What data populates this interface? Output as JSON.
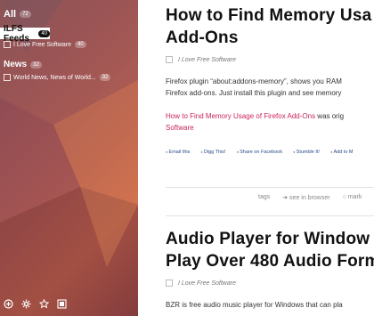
{
  "sidebar": {
    "all": {
      "label": "All",
      "count": "72"
    },
    "ilfs": {
      "label": "ILFS Feeds",
      "count": "40"
    },
    "ilfs_feed": {
      "label": "I Love Free Software",
      "count": "40"
    },
    "news": {
      "label": "News",
      "count": "32"
    },
    "news_feed": {
      "label": "World News, News of World...",
      "count": "32"
    },
    "bottom_icons": [
      "add-icon",
      "gear-icon",
      "star-icon",
      "square-icon"
    ]
  },
  "articles": [
    {
      "title_l1": "How to Find Memory Usa",
      "title_l2": "Add-Ons",
      "source": "I Love Free Software",
      "p1": "Firefox plugin “about:addons-memory”, shows you RAM",
      "p2": "Firefox add-ons. Just install this plugin and see memory",
      "link_text": "How to Find Memory Usage of Firefox Add-Ons",
      "link_suffix": " was orig",
      "link_l2": "Software",
      "share": [
        "Email this",
        "Digg This!",
        "Share on Facebook",
        "Stumble It!",
        "Add to M"
      ]
    },
    {
      "title_l1": "Audio Player for Window",
      "title_l2": "Play Over 480 Audio Form",
      "source": "I Love Free Software",
      "p1": "BZR is free audio music player for Windows that can pla"
    }
  ],
  "actions": {
    "tags": "tags",
    "see_in_browser": "see in browser",
    "mark": "mark"
  }
}
